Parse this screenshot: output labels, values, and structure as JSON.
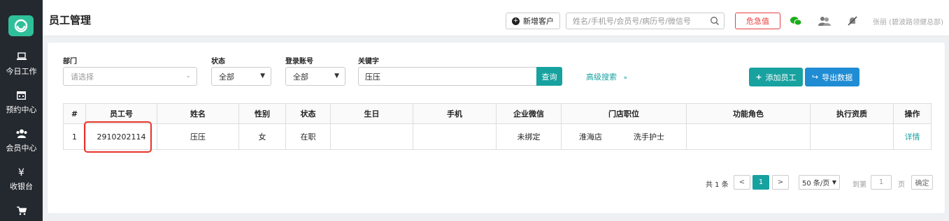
{
  "sidebar": {
    "logo": "brand-logo-icon",
    "items": [
      {
        "label": "今日工作",
        "icon": "laptop-icon"
      },
      {
        "label": "预约中心",
        "icon": "calendar-icon"
      },
      {
        "label": "会员中心",
        "icon": "members-icon"
      },
      {
        "label": "收银台",
        "icon": "yen-icon",
        "glyph": "¥"
      },
      {
        "label": "",
        "icon": "cart-icon"
      }
    ]
  },
  "header": {
    "title": "员工管理",
    "new_customer_label": "新增客户",
    "search_placeholder": "姓名/手机号/会员号/病历号/微信号",
    "critical_label": "危急值",
    "user": "张丽 (碧波路领健总部)"
  },
  "filters": {
    "dept_label": "部门",
    "dept_placeholder": "请选择",
    "status_label": "状态",
    "status_value": "全部",
    "account_label": "登录账号",
    "account_value": "全部",
    "keyword_label": "关键字",
    "keyword_value": "压压",
    "query_label": "查询",
    "advanced_label": "高级搜索",
    "add_employee_label": "添加员工",
    "export_label": "导出数据"
  },
  "table": {
    "headers": [
      "#",
      "员工号",
      "姓名",
      "性别",
      "状态",
      "生日",
      "手机",
      "企业微信",
      "门店职位",
      "功能角色",
      "执行资质",
      "操作"
    ],
    "rows": [
      {
        "no": "1",
        "emp_id": "2910202114",
        "name": "压压",
        "gender": "女",
        "status": "在职",
        "birthday": "",
        "phone": "",
        "wecom": "未绑定",
        "store": "淮海店",
        "position": "洗手护士",
        "role": "",
        "qualification": "",
        "action": "详情"
      }
    ]
  },
  "pagination": {
    "total": "共 1 条",
    "prev": "<",
    "current": "1",
    "next": ">",
    "page_size": "50 条/页",
    "goto_label": "到第",
    "goto_value": "1",
    "page_unit": "页",
    "confirm": "确定"
  },
  "colors": {
    "sidebar_bg": "#24292f",
    "brand": "#2fbf9a",
    "accent": "#17a2a0",
    "export": "#1f8cd3",
    "danger": "#e83e3e"
  }
}
